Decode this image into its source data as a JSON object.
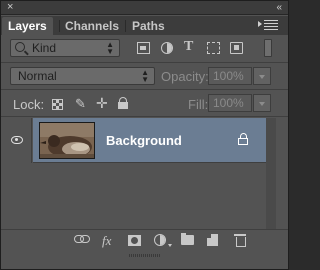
{
  "window": {
    "collapse_glyph": "«",
    "close_glyph": "×"
  },
  "tabs": [
    {
      "label": "Layers",
      "active": true
    },
    {
      "label": "Channels",
      "active": false
    },
    {
      "label": "Paths",
      "active": false
    }
  ],
  "filter": {
    "kind_label": "Kind",
    "type_icons": [
      "pixel-filter-icon",
      "adjustment-filter-icon",
      "type-filter-icon",
      "shape-filter-icon",
      "smart-object-filter-icon"
    ],
    "type_glyph": "T"
  },
  "blend": {
    "mode": "Normal",
    "opacity_label": "Opacity:",
    "opacity_value": "100%"
  },
  "locks": {
    "label": "Lock:",
    "fill_label": "Fill:",
    "fill_value": "100%",
    "brush_glyph": "✎",
    "move_glyph": "✛"
  },
  "layers": [
    {
      "name": "Background",
      "visible": true,
      "locked": true,
      "selected": true
    }
  ],
  "bottom_bar": {
    "fx_label": "fx",
    "icons": [
      "link-layers-icon",
      "fx-icon",
      "add-mask-icon",
      "adjustment-layer-icon",
      "new-group-icon",
      "new-layer-icon",
      "delete-layer-icon"
    ]
  },
  "colors": {
    "panel_bg": "#535353",
    "selected_layer": "#6b7d93",
    "tab_bar": "#3c3c3c"
  }
}
